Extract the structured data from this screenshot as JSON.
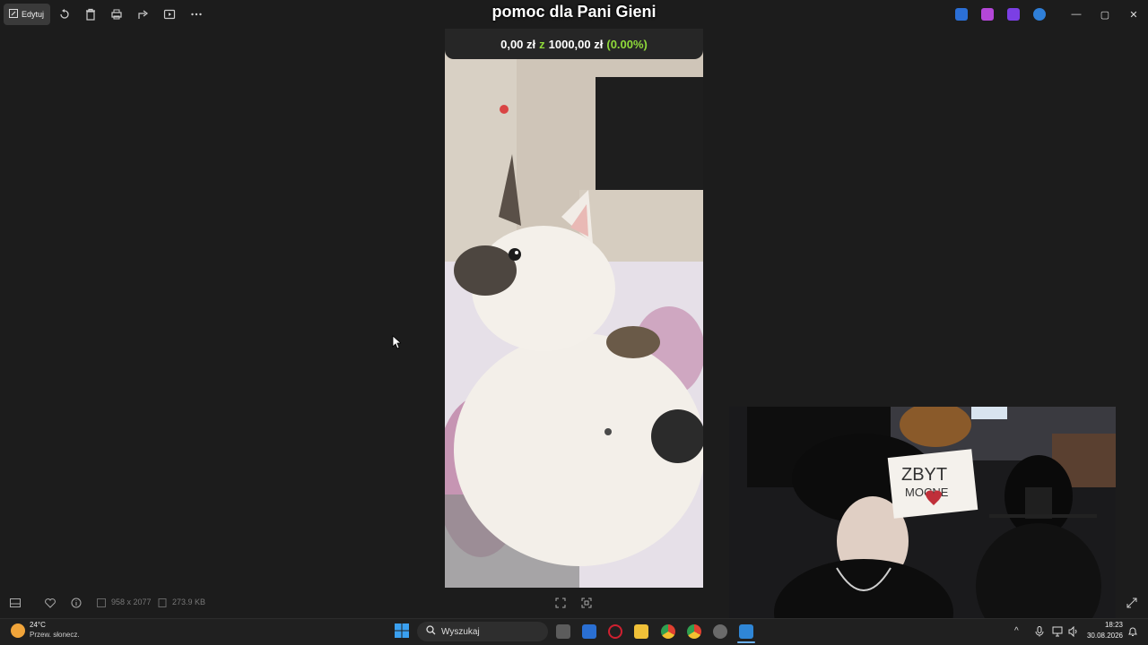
{
  "toolbar": {
    "edit_label": "Edytuj",
    "icons": [
      "rotate-icon",
      "delete-icon",
      "print-icon",
      "share-icon",
      "slideshow-icon",
      "more-icon"
    ]
  },
  "window_controls": {
    "minimize": "—",
    "maximize": "▢",
    "close": "✕"
  },
  "stream_overlay": {
    "title": "pomoc dla Pani Gieni",
    "amount_raised": "0,00 zł",
    "separator": "z",
    "goal": "1000,00 zł",
    "percent": "(0.00%)",
    "progress": 0.0
  },
  "webcam_sign": {
    "line1": "ZBYT",
    "line2": "MOCNE"
  },
  "status_bar": {
    "dimensions": "958 x 2077",
    "file_size": "273.9 KB"
  },
  "taskbar": {
    "weather_temp": "24°C",
    "weather_desc": "Przew. słonecz.",
    "search_placeholder": "Wyszukaj",
    "time": "18:23",
    "date": "30.08.2026"
  },
  "colors": {
    "accent_green": "#8fd93a",
    "background": "#1c1c1c",
    "taskbar": "#202020"
  }
}
